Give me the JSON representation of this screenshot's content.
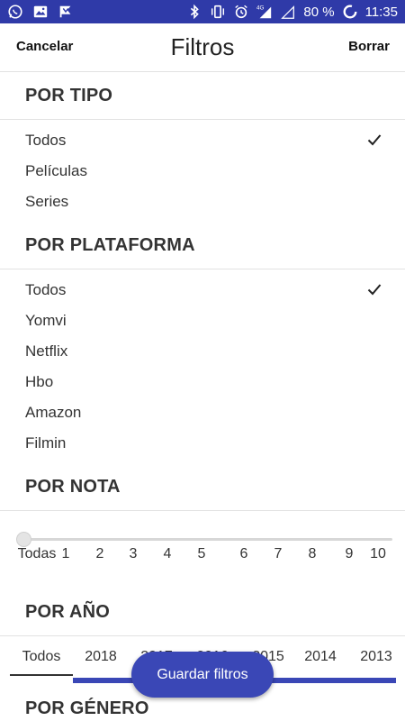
{
  "status_bar": {
    "left_icons": [
      "whatsapp-icon",
      "image-icon",
      "flag-icon"
    ],
    "battery": "80 %",
    "time": "11:35",
    "network": "4G"
  },
  "header": {
    "cancel": "Cancelar",
    "title": "Filtros",
    "clear": "Borrar"
  },
  "sections": {
    "tipo": {
      "title": "POR TIPO",
      "options": [
        "Todos",
        "Películas",
        "Series"
      ],
      "selected": "Todos"
    },
    "plataforma": {
      "title": "POR PLATAFORMA",
      "options": [
        "Todos",
        "Yomvi",
        "Netflix",
        "Hbo",
        "Amazon",
        "Filmin"
      ],
      "selected": "Todos"
    },
    "nota": {
      "title": "POR NOTA",
      "ticks": [
        "Todas",
        "1",
        "2",
        "3",
        "4",
        "5",
        "6",
        "7",
        "8",
        "9",
        "10"
      ],
      "value": "Todas"
    },
    "anio": {
      "title": "POR AÑO",
      "years": [
        "Todos",
        "2018",
        "2017",
        "2016",
        "2015",
        "2014",
        "2013"
      ],
      "selected": "Todos"
    },
    "genero": {
      "title": "POR GÉNERO"
    }
  },
  "fab": {
    "label": "Guardar filtros"
  },
  "colors": {
    "accent": "#3a47b6",
    "status_bar": "#2f3aa8"
  }
}
